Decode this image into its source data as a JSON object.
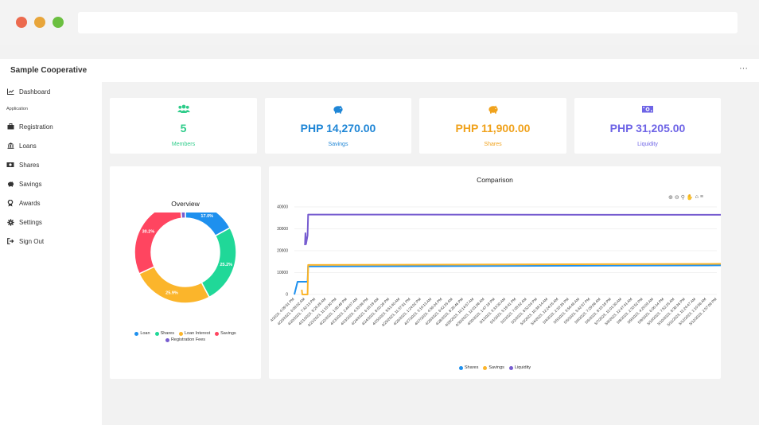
{
  "app": {
    "title": "Sample Cooperative",
    "more_label": "···"
  },
  "sidebar": {
    "items": [
      {
        "label": "Dashboard",
        "icon": "line-chart-icon"
      },
      {
        "label": "Registration",
        "icon": "briefcase-icon"
      },
      {
        "label": "Loans",
        "icon": "bank-icon"
      },
      {
        "label": "Shares",
        "icon": "money-icon"
      },
      {
        "label": "Savings",
        "icon": "piggy-bank-icon"
      },
      {
        "label": "Awards",
        "icon": "award-icon"
      },
      {
        "label": "Settings",
        "icon": "gear-icon"
      },
      {
        "label": "Sign Out",
        "icon": "sign-out-icon"
      }
    ],
    "section_label": "Application"
  },
  "stats": [
    {
      "value": "5",
      "label": "Members",
      "color": "#2ecc8a",
      "icon": "users-icon"
    },
    {
      "value": "PHP 14,270.00",
      "label": "Savings",
      "color": "#1f86d6",
      "icon": "piggy-bank-icon"
    },
    {
      "value": "PHP 11,900.00",
      "label": "Shares",
      "color": "#f0a21c",
      "icon": "piggy-bank-icon"
    },
    {
      "value": "PHP 31,205.00",
      "label": "Liquidity",
      "color": "#6e64e6",
      "icon": "money-icon"
    }
  ],
  "chart_data": [
    {
      "type": "pie",
      "title": "Overview",
      "donut": true,
      "categories": [
        "Loan",
        "Shares",
        "Loan Interest",
        "Savings",
        "Registration Fees"
      ],
      "values": [
        17.0,
        25.2,
        25.9,
        30.2,
        1.7
      ],
      "data_labels": [
        "17.0%",
        "25.2%",
        "25.9%",
        "30.2%",
        ""
      ],
      "colors": [
        "#1e90ee",
        "#20d898",
        "#fbb52b",
        "#ff4560",
        "#775dd0"
      ],
      "legend": "bottom"
    },
    {
      "type": "line",
      "title": "Comparison",
      "ylim": [
        0,
        40000
      ],
      "yticks": [
        "0",
        "10000",
        "20000",
        "30000",
        "40000"
      ],
      "grid": true,
      "legend": "bottom",
      "x_labels": [
        "4/2023, 4:09:51 PM",
        "4/20/2023, 6:09:02 AM",
        "4/20/2023, 7:42:13 PM",
        "4/21/2023, 9:26:28 AM",
        "4/21/2023, 11:15:30 PM",
        "4/22/2023, 1:00:49 PM",
        "4/23/2023, 2:46:07 AM",
        "4/23/2023, 4:33:08 PM",
        "4/24/2023, 6:18:19 AM",
        "4/24/2023, 8:03:29 PM",
        "4/25/2023, 9:51:40 AM",
        "4/25/2023, 11:37:51 PM",
        "4/26/2023, 1:24:02 PM",
        "4/27/2023, 3:10:13 AM",
        "4/27/2023, 4:56:24 PM",
        "4/28/2023, 6:42:35 AM",
        "4/28/2023, 8:28:46 PM",
        "4/29/2023, 10:14:57 AM",
        "4/30/2023, 12:01:08 AM",
        "4/30/2023, 1:47:19 PM",
        "5/1/2023, 3:33:30 AM",
        "5/1/2023, 5:19:41 PM",
        "5/2/2023, 7:05:52 AM",
        "5/2/2023, 8:52:03 PM",
        "5/3/2023, 10:38:14 AM",
        "5/4/2023, 12:24:25 AM",
        "5/4/2023, 2:10:35 PM",
        "5/5/2023, 3:56:46 AM",
        "5/5/2023, 5:42:57 PM",
        "5/6/2023, 7:29:08 AM",
        "5/6/2023, 9:15:19 PM",
        "5/7/2023, 11:01:30 AM",
        "5/8/2023, 12:47:41 AM",
        "5/8/2023, 2:33:52 PM",
        "5/9/2023, 4:20:03 AM",
        "5/9/2023, 6:06:14 PM",
        "5/10/2023, 7:52:25 AM",
        "5/10/2023, 9:38:36 PM",
        "5/11/2023, 11:24:47 AM",
        "5/12/2023, 1:10:58 AM",
        "5/12/2023, 2:57:09 PM"
      ],
      "series": [
        {
          "name": "Shares",
          "color": "#1e90ee",
          "x": [
            0,
            0.3,
            0.5,
            0.8,
            1.1,
            1.25,
            1.3,
            40.8,
            41
          ],
          "y": [
            0,
            5800,
            5800,
            5800,
            5800,
            5800,
            12800,
            13300,
            13000
          ]
        },
        {
          "name": "Savings",
          "color": "#fbb52b",
          "x": [
            0.7,
            0.75,
            1.0,
            1.25,
            1.3,
            41
          ],
          "y": [
            2200,
            0,
            0,
            0,
            13500,
            14000
          ]
        },
        {
          "name": "Liquidity",
          "color": "#775dd0",
          "x": [
            1.0,
            1.05,
            1.1,
            1.25,
            1.3,
            40.8,
            41
          ],
          "y": [
            22500,
            28000,
            23000,
            27000,
            36500,
            36400,
            37000
          ]
        }
      ]
    }
  ]
}
